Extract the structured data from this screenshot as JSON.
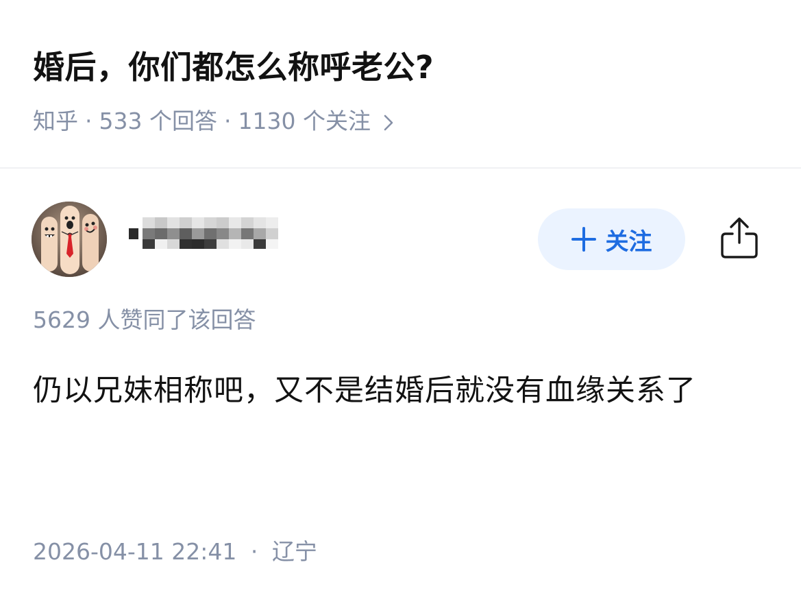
{
  "question": {
    "title": "婚后，你们都怎么称呼老公?",
    "source": "知乎",
    "separator": "·",
    "answers_count": "533 个回答",
    "followers_count": "1130 个关注"
  },
  "author": {
    "follow_label": "关注"
  },
  "answer": {
    "votes_text": "5629 人赞同了该回答",
    "content": "仍以兄妹相称吧，又不是结婚后就没有血缘关系了",
    "timestamp": "2026-04-11 22:41",
    "separator": "·",
    "location": "辽宁"
  },
  "icons": {
    "plus": "plus-icon",
    "share": "share-icon",
    "chevron": "chevron-right-icon"
  },
  "colors": {
    "accent": "#1e6ce1",
    "follow_bg": "#ebf3ff",
    "meta_gray": "#8590a6",
    "text": "#121212"
  }
}
